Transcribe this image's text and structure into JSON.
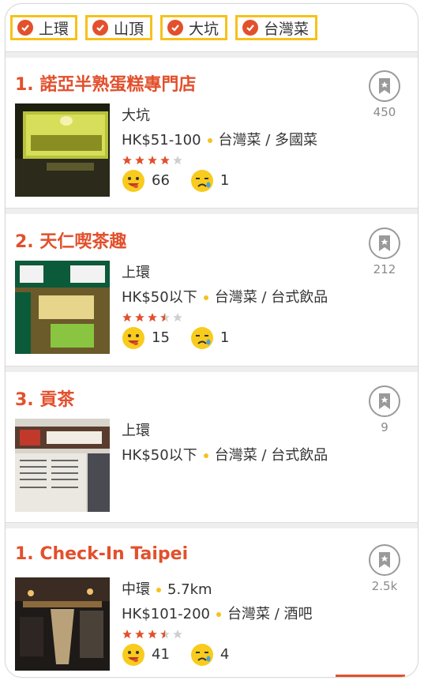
{
  "filters": [
    {
      "label": "上環"
    },
    {
      "label": "山頂"
    },
    {
      "label": "大坑"
    },
    {
      "label": "台灣菜"
    }
  ],
  "restaurants": [
    {
      "title": "1. 諾亞半熟蛋糕專門店",
      "district": "大坑",
      "price": "HK$51-100",
      "cuisine": "台灣菜 / 多國菜",
      "rating": 4,
      "smile": "66",
      "cry": "1",
      "bookmarks": "450"
    },
    {
      "title": "2. 天仁喫茶趣",
      "district": "上環",
      "price": "HK$50以下",
      "cuisine": "台灣菜 / 台式飲品",
      "rating": 3.5,
      "smile": "15",
      "cry": "1",
      "bookmarks": "212"
    },
    {
      "title": "3. 貢茶",
      "district": "上環",
      "price": "HK$50以下",
      "cuisine": "台灣菜 / 台式飲品",
      "bookmarks": "9"
    },
    {
      "title": "1. Check-In Taipei",
      "district": "中環",
      "distance": "5.7km",
      "price": "HK$101-200",
      "cuisine": "台灣菜 / 酒吧",
      "rating": 3.5,
      "smile": "41",
      "cry": "4",
      "bookmarks": "2.5k"
    }
  ],
  "colors": {
    "accent": "#e2502c",
    "chip_border": "#f6c21b",
    "star_on": "#e2502c",
    "star_off": "#cfcfcf"
  },
  "icons": {
    "chip": "check-circle-icon",
    "bookmark": "bookmark-star-icon",
    "smile": "smile-emoji-icon",
    "cry": "cry-emoji-icon"
  }
}
